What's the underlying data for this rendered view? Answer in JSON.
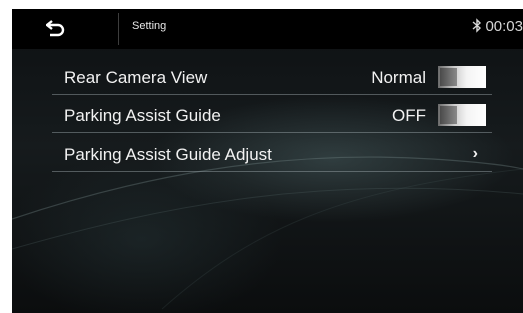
{
  "header": {
    "back_icon": "back-arrow-icon",
    "title": "Setting",
    "bluetooth_icon": "bluetooth-icon",
    "clock": "00:03"
  },
  "settings": [
    {
      "label": "Rear Camera View",
      "value": "Normal",
      "control": "toggle"
    },
    {
      "label": "Parking Assist Guide",
      "value": "OFF",
      "control": "toggle"
    },
    {
      "label": "Parking Assist Guide Adjust",
      "control": "chevron",
      "chevron": "›"
    }
  ]
}
